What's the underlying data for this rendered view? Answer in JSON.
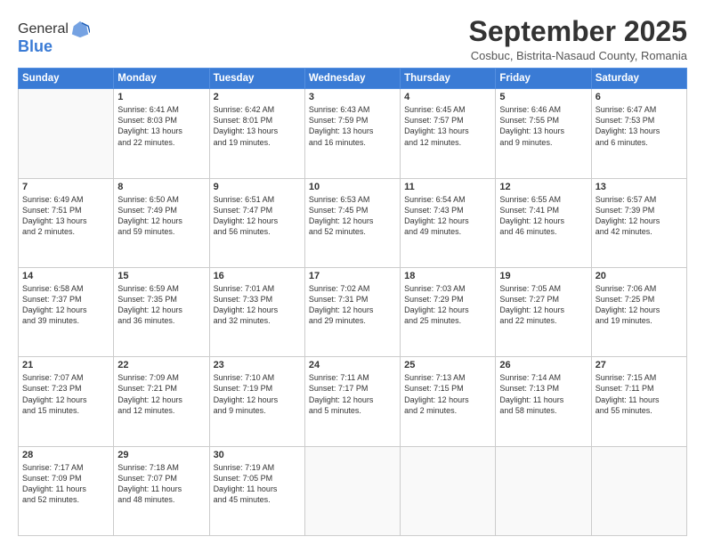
{
  "logo": {
    "general": "General",
    "blue": "Blue"
  },
  "header": {
    "month": "September 2025",
    "location": "Cosbuc, Bistrita-Nasaud County, Romania"
  },
  "days_of_week": [
    "Sunday",
    "Monday",
    "Tuesday",
    "Wednesday",
    "Thursday",
    "Friday",
    "Saturday"
  ],
  "weeks": [
    [
      {
        "day": "",
        "info": ""
      },
      {
        "day": "1",
        "info": "Sunrise: 6:41 AM\nSunset: 8:03 PM\nDaylight: 13 hours\nand 22 minutes."
      },
      {
        "day": "2",
        "info": "Sunrise: 6:42 AM\nSunset: 8:01 PM\nDaylight: 13 hours\nand 19 minutes."
      },
      {
        "day": "3",
        "info": "Sunrise: 6:43 AM\nSunset: 7:59 PM\nDaylight: 13 hours\nand 16 minutes."
      },
      {
        "day": "4",
        "info": "Sunrise: 6:45 AM\nSunset: 7:57 PM\nDaylight: 13 hours\nand 12 minutes."
      },
      {
        "day": "5",
        "info": "Sunrise: 6:46 AM\nSunset: 7:55 PM\nDaylight: 13 hours\nand 9 minutes."
      },
      {
        "day": "6",
        "info": "Sunrise: 6:47 AM\nSunset: 7:53 PM\nDaylight: 13 hours\nand 6 minutes."
      }
    ],
    [
      {
        "day": "7",
        "info": "Sunrise: 6:49 AM\nSunset: 7:51 PM\nDaylight: 13 hours\nand 2 minutes."
      },
      {
        "day": "8",
        "info": "Sunrise: 6:50 AM\nSunset: 7:49 PM\nDaylight: 12 hours\nand 59 minutes."
      },
      {
        "day": "9",
        "info": "Sunrise: 6:51 AM\nSunset: 7:47 PM\nDaylight: 12 hours\nand 56 minutes."
      },
      {
        "day": "10",
        "info": "Sunrise: 6:53 AM\nSunset: 7:45 PM\nDaylight: 12 hours\nand 52 minutes."
      },
      {
        "day": "11",
        "info": "Sunrise: 6:54 AM\nSunset: 7:43 PM\nDaylight: 12 hours\nand 49 minutes."
      },
      {
        "day": "12",
        "info": "Sunrise: 6:55 AM\nSunset: 7:41 PM\nDaylight: 12 hours\nand 46 minutes."
      },
      {
        "day": "13",
        "info": "Sunrise: 6:57 AM\nSunset: 7:39 PM\nDaylight: 12 hours\nand 42 minutes."
      }
    ],
    [
      {
        "day": "14",
        "info": "Sunrise: 6:58 AM\nSunset: 7:37 PM\nDaylight: 12 hours\nand 39 minutes."
      },
      {
        "day": "15",
        "info": "Sunrise: 6:59 AM\nSunset: 7:35 PM\nDaylight: 12 hours\nand 36 minutes."
      },
      {
        "day": "16",
        "info": "Sunrise: 7:01 AM\nSunset: 7:33 PM\nDaylight: 12 hours\nand 32 minutes."
      },
      {
        "day": "17",
        "info": "Sunrise: 7:02 AM\nSunset: 7:31 PM\nDaylight: 12 hours\nand 29 minutes."
      },
      {
        "day": "18",
        "info": "Sunrise: 7:03 AM\nSunset: 7:29 PM\nDaylight: 12 hours\nand 25 minutes."
      },
      {
        "day": "19",
        "info": "Sunrise: 7:05 AM\nSunset: 7:27 PM\nDaylight: 12 hours\nand 22 minutes."
      },
      {
        "day": "20",
        "info": "Sunrise: 7:06 AM\nSunset: 7:25 PM\nDaylight: 12 hours\nand 19 minutes."
      }
    ],
    [
      {
        "day": "21",
        "info": "Sunrise: 7:07 AM\nSunset: 7:23 PM\nDaylight: 12 hours\nand 15 minutes."
      },
      {
        "day": "22",
        "info": "Sunrise: 7:09 AM\nSunset: 7:21 PM\nDaylight: 12 hours\nand 12 minutes."
      },
      {
        "day": "23",
        "info": "Sunrise: 7:10 AM\nSunset: 7:19 PM\nDaylight: 12 hours\nand 9 minutes."
      },
      {
        "day": "24",
        "info": "Sunrise: 7:11 AM\nSunset: 7:17 PM\nDaylight: 12 hours\nand 5 minutes."
      },
      {
        "day": "25",
        "info": "Sunrise: 7:13 AM\nSunset: 7:15 PM\nDaylight: 12 hours\nand 2 minutes."
      },
      {
        "day": "26",
        "info": "Sunrise: 7:14 AM\nSunset: 7:13 PM\nDaylight: 11 hours\nand 58 minutes."
      },
      {
        "day": "27",
        "info": "Sunrise: 7:15 AM\nSunset: 7:11 PM\nDaylight: 11 hours\nand 55 minutes."
      }
    ],
    [
      {
        "day": "28",
        "info": "Sunrise: 7:17 AM\nSunset: 7:09 PM\nDaylight: 11 hours\nand 52 minutes."
      },
      {
        "day": "29",
        "info": "Sunrise: 7:18 AM\nSunset: 7:07 PM\nDaylight: 11 hours\nand 48 minutes."
      },
      {
        "day": "30",
        "info": "Sunrise: 7:19 AM\nSunset: 7:05 PM\nDaylight: 11 hours\nand 45 minutes."
      },
      {
        "day": "",
        "info": ""
      },
      {
        "day": "",
        "info": ""
      },
      {
        "day": "",
        "info": ""
      },
      {
        "day": "",
        "info": ""
      }
    ]
  ]
}
